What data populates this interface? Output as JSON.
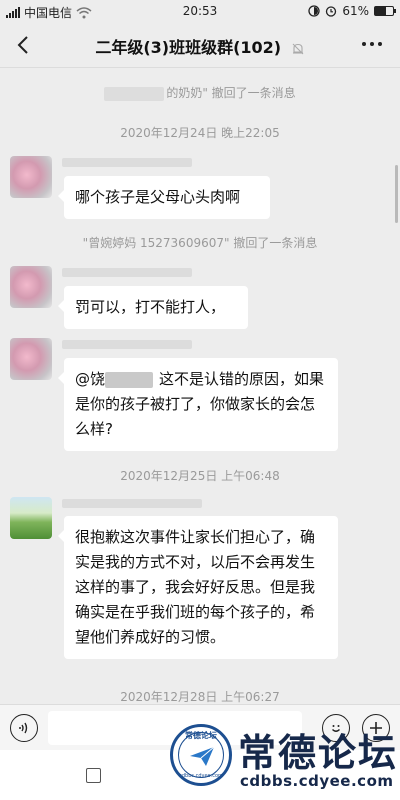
{
  "status_bar": {
    "carrier": "中国电信",
    "time": "20:53",
    "battery": "61%",
    "battery_level": 0.61
  },
  "nav": {
    "title": "二年级(3)班班级群(102)"
  },
  "messages": {
    "recall_1": "的奶奶\" 撤回了一条消息",
    "time_1": "2020年12月24日 晚上22:05",
    "msg_1": "哪个孩子是父母心头肉啊",
    "recall_2": "\"曾婉婷妈 15273609607\" 撤回了一条消息",
    "msg_2": "罚可以，打不能打人，",
    "msg_3_prefix": "@饶",
    "msg_3_body": "这不是认错的原因，如果是你的孩子被打了，你做家长的会怎么样?",
    "time_2": "2020年12月25日 上午06:48",
    "msg_4": "很抱歉这次事件让家长们担心了，确实是我的方式不对，以后不会再发生这样的事了，我会好好反思。但是我确实是在乎我们班的每个孩子的，希望他们养成好的习惯。",
    "time_3": "2020年12月28日 上午06:27"
  },
  "watermark": {
    "name": "常德论坛",
    "url": "cdbbs.cdyee.com",
    "logo_text": "常德论坛",
    "logo_url": "cdbbs.cdyee.com"
  },
  "icons": {
    "back": "chevron-left-icon",
    "mute": "bell-muted-icon",
    "more": "more-dots-icon",
    "voice": "voice-icon",
    "emoji": "emoji-icon",
    "plus": "plus-icon",
    "home": "square-icon"
  }
}
